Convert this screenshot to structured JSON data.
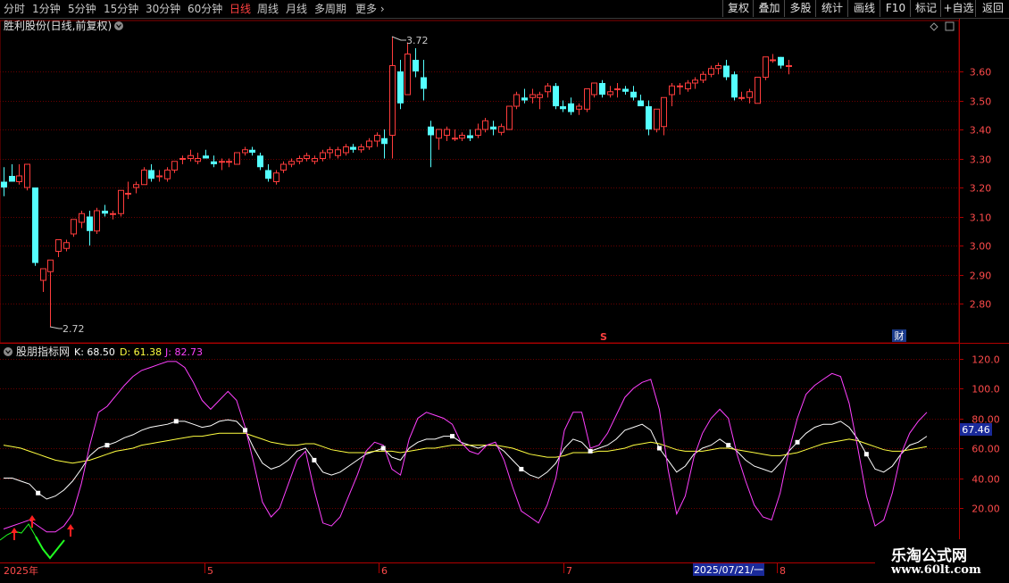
{
  "toolbar": {
    "periods": [
      "分时",
      "1分钟",
      "5分钟",
      "15分钟",
      "30分钟",
      "60分钟",
      "日线",
      "周线",
      "月线",
      "多周期",
      "更多"
    ],
    "active_period": "日线",
    "more_icon": "chevron-right-icon",
    "buttons": [
      "复权",
      "叠加",
      "多股",
      "统计",
      "画线",
      "F10",
      "标记",
      "+自选",
      "返回"
    ]
  },
  "price_panel": {
    "title": "胜利股份(日线,前复权)",
    "title_icon": "chevron-down-icon",
    "high_label": "3.72",
    "low_label": "2.72",
    "y_ticks": [
      "3.60",
      "3.50",
      "3.40",
      "3.30",
      "3.20",
      "3.10",
      "3.00",
      "2.90",
      "2.80"
    ],
    "markers": [
      "S",
      "财"
    ],
    "corner_icons": [
      "diamond-icon",
      "maximize-icon"
    ]
  },
  "indicator_panel": {
    "title": "股朋指标网",
    "title_icon": "chevron-down-icon",
    "k_label": "K: 68.50",
    "d_label": "D: 61.38",
    "j_label": "J: 82.73",
    "y_ticks": [
      "120.0",
      "100.0",
      "80.00",
      "60.00",
      "40.00",
      "20.00"
    ],
    "current_value_tag": "67.46"
  },
  "time_axis": {
    "labels": [
      "2025年",
      "5",
      "6",
      "7",
      "8"
    ],
    "cursor_date": "2025/07/21/一"
  },
  "watermark": {
    "line1": "乐淘公式网",
    "line2": "www.60lt.com"
  },
  "colors": {
    "background": "#000000",
    "up_candle": "#ff3c3c",
    "down_candle": "#54ffff",
    "k_line": "#ffffff",
    "d_line": "#ffff40",
    "j_line": "#ff40ff",
    "grid": "#6a0000",
    "axis_text": "#ff4b4b",
    "buy_arrow": "#ff2020",
    "green_segment": "#20ff20"
  },
  "chart_data": [
    {
      "type": "candlestick",
      "title": "胜利股份(日线,前复权)",
      "ylim": [
        2.72,
        3.72
      ],
      "y_ticks": [
        3.6,
        3.5,
        3.4,
        3.3,
        3.2,
        3.1,
        3.0,
        2.9,
        2.8
      ],
      "x_labels": [
        "2025年",
        "5",
        "6",
        "7",
        "8"
      ],
      "extremes": {
        "high": 3.72,
        "low": 2.72
      },
      "ohlc": [
        [
          3.22,
          3.27,
          3.17,
          3.2
        ],
        [
          3.24,
          3.28,
          3.22,
          3.22
        ],
        [
          3.22,
          3.28,
          3.21,
          3.24
        ],
        [
          3.2,
          3.28,
          3.19,
          3.28
        ],
        [
          3.2,
          3.2,
          2.93,
          2.94
        ],
        [
          2.88,
          2.92,
          2.84,
          2.92
        ],
        [
          2.91,
          2.95,
          2.72,
          2.95
        ],
        [
          2.98,
          3.02,
          2.96,
          3.02
        ],
        [
          2.99,
          3.02,
          2.98,
          3.01
        ],
        [
          3.04,
          3.09,
          3.03,
          3.09
        ],
        [
          3.08,
          3.12,
          3.06,
          3.11
        ],
        [
          3.1,
          3.12,
          3.0,
          3.05
        ],
        [
          3.05,
          3.13,
          3.04,
          3.12
        ],
        [
          3.12,
          3.14,
          3.1,
          3.11
        ],
        [
          3.11,
          3.12,
          3.09,
          3.11
        ],
        [
          3.11,
          3.19,
          3.1,
          3.19
        ],
        [
          3.18,
          3.22,
          3.16,
          3.18
        ],
        [
          3.2,
          3.22,
          3.18,
          3.21
        ],
        [
          3.21,
          3.27,
          3.21,
          3.26
        ],
        [
          3.26,
          3.28,
          3.22,
          3.23
        ],
        [
          3.24,
          3.26,
          3.22,
          3.24
        ],
        [
          3.23,
          3.27,
          3.22,
          3.26
        ],
        [
          3.26,
          3.29,
          3.25,
          3.29
        ],
        [
          3.3,
          3.31,
          3.28,
          3.3
        ],
        [
          3.3,
          3.33,
          3.29,
          3.31
        ],
        [
          3.29,
          3.32,
          3.28,
          3.3
        ],
        [
          3.31,
          3.33,
          3.3,
          3.3
        ],
        [
          3.29,
          3.31,
          3.27,
          3.28
        ],
        [
          3.29,
          3.3,
          3.26,
          3.29
        ],
        [
          3.29,
          3.3,
          3.27,
          3.29
        ],
        [
          3.28,
          3.32,
          3.28,
          3.32
        ],
        [
          3.32,
          3.34,
          3.31,
          3.33
        ],
        [
          3.33,
          3.34,
          3.31,
          3.32
        ],
        [
          3.31,
          3.32,
          3.26,
          3.27
        ],
        [
          3.26,
          3.28,
          3.22,
          3.23
        ],
        [
          3.22,
          3.26,
          3.21,
          3.25
        ],
        [
          3.26,
          3.29,
          3.25,
          3.28
        ],
        [
          3.28,
          3.3,
          3.27,
          3.29
        ],
        [
          3.29,
          3.31,
          3.28,
          3.3
        ],
        [
          3.3,
          3.32,
          3.29,
          3.31
        ],
        [
          3.29,
          3.31,
          3.28,
          3.3
        ],
        [
          3.3,
          3.33,
          3.29,
          3.32
        ],
        [
          3.32,
          3.34,
          3.3,
          3.33
        ],
        [
          3.31,
          3.34,
          3.3,
          3.33
        ],
        [
          3.32,
          3.35,
          3.31,
          3.34
        ],
        [
          3.34,
          3.35,
          3.32,
          3.33
        ],
        [
          3.33,
          3.35,
          3.32,
          3.34
        ],
        [
          3.34,
          3.37,
          3.33,
          3.36
        ],
        [
          3.36,
          3.39,
          3.34,
          3.38
        ],
        [
          3.37,
          3.4,
          3.3,
          3.35
        ],
        [
          3.38,
          3.72,
          3.3,
          3.62
        ],
        [
          3.6,
          3.64,
          3.47,
          3.49
        ],
        [
          3.52,
          3.7,
          3.52,
          3.66
        ],
        [
          3.64,
          3.68,
          3.58,
          3.6
        ],
        [
          3.58,
          3.64,
          3.5,
          3.54
        ],
        [
          3.41,
          3.43,
          3.27,
          3.38
        ],
        [
          3.37,
          3.4,
          3.33,
          3.4
        ],
        [
          3.38,
          3.41,
          3.36,
          3.4
        ],
        [
          3.37,
          3.4,
          3.36,
          3.37
        ],
        [
          3.37,
          3.39,
          3.36,
          3.38
        ],
        [
          3.38,
          3.4,
          3.36,
          3.37
        ],
        [
          3.38,
          3.42,
          3.37,
          3.4
        ],
        [
          3.4,
          3.44,
          3.39,
          3.43
        ],
        [
          3.41,
          3.43,
          3.38,
          3.4
        ],
        [
          3.39,
          3.42,
          3.38,
          3.41
        ],
        [
          3.4,
          3.48,
          3.4,
          3.48
        ],
        [
          3.48,
          3.53,
          3.47,
          3.52
        ],
        [
          3.51,
          3.54,
          3.49,
          3.5
        ],
        [
          3.51,
          3.54,
          3.49,
          3.52
        ],
        [
          3.51,
          3.53,
          3.47,
          3.52
        ],
        [
          3.53,
          3.56,
          3.51,
          3.55
        ],
        [
          3.55,
          3.56,
          3.47,
          3.48
        ],
        [
          3.48,
          3.5,
          3.46,
          3.47
        ],
        [
          3.49,
          3.51,
          3.45,
          3.46
        ],
        [
          3.47,
          3.49,
          3.45,
          3.48
        ],
        [
          3.47,
          3.54,
          3.46,
          3.54
        ],
        [
          3.52,
          3.56,
          3.51,
          3.56
        ],
        [
          3.56,
          3.57,
          3.51,
          3.52
        ],
        [
          3.52,
          3.55,
          3.51,
          3.53
        ],
        [
          3.54,
          3.56,
          3.51,
          3.54
        ],
        [
          3.54,
          3.55,
          3.52,
          3.53
        ],
        [
          3.53,
          3.55,
          3.5,
          3.51
        ],
        [
          3.5,
          3.52,
          3.48,
          3.48
        ],
        [
          3.48,
          3.5,
          3.38,
          3.4
        ],
        [
          3.4,
          3.47,
          3.39,
          3.47
        ],
        [
          3.41,
          3.5,
          3.38,
          3.51
        ],
        [
          3.52,
          3.56,
          3.48,
          3.55
        ],
        [
          3.55,
          3.56,
          3.52,
          3.55
        ],
        [
          3.54,
          3.57,
          3.53,
          3.56
        ],
        [
          3.56,
          3.58,
          3.54,
          3.57
        ],
        [
          3.57,
          3.6,
          3.56,
          3.59
        ],
        [
          3.59,
          3.62,
          3.58,
          3.61
        ],
        [
          3.61,
          3.63,
          3.59,
          3.62
        ],
        [
          3.62,
          3.64,
          3.57,
          3.58
        ],
        [
          3.59,
          3.6,
          3.5,
          3.51
        ],
        [
          3.51,
          3.53,
          3.5,
          3.51
        ],
        [
          3.51,
          3.54,
          3.49,
          3.53
        ],
        [
          3.49,
          3.58,
          3.49,
          3.58
        ],
        [
          3.58,
          3.65,
          3.57,
          3.65
        ],
        [
          3.64,
          3.66,
          3.63,
          3.64
        ],
        [
          3.65,
          3.65,
          3.61,
          3.62
        ],
        [
          3.62,
          3.64,
          3.59,
          3.62
        ]
      ]
    },
    {
      "type": "line",
      "title": "股朋指标网",
      "ylim": [
        0,
        130
      ],
      "y_ticks": [
        120,
        100,
        80,
        60,
        40,
        20
      ],
      "series": [
        {
          "name": "K",
          "values": [
            40,
            40,
            38,
            36,
            30,
            26,
            28,
            32,
            38,
            46,
            55,
            60,
            62,
            64,
            67,
            69,
            72,
            74,
            75,
            76,
            78,
            78,
            76,
            74,
            75,
            78,
            79,
            78,
            72,
            60,
            50,
            46,
            48,
            52,
            58,
            60,
            52,
            44,
            42,
            44,
            48,
            52,
            56,
            58,
            60,
            54,
            52,
            60,
            64,
            66,
            66,
            68,
            68,
            64,
            62,
            60,
            62,
            62,
            58,
            52,
            46,
            42,
            40,
            44,
            50,
            60,
            66,
            64,
            58,
            60,
            62,
            66,
            72,
            74,
            76,
            72,
            60,
            52,
            44,
            48,
            56,
            60,
            62,
            66,
            62,
            58,
            52,
            48,
            46,
            44,
            50,
            58,
            64,
            70,
            74,
            76,
            76,
            78,
            74,
            66,
            56,
            46,
            44,
            48,
            56,
            62,
            64,
            68
          ]
        },
        {
          "name": "D",
          "values": [
            62,
            61,
            60,
            58,
            56,
            54,
            52,
            51,
            50,
            51,
            52,
            54,
            56,
            58,
            59,
            60,
            62,
            63,
            64,
            65,
            66,
            67,
            68,
            68,
            69,
            70,
            70,
            70,
            70,
            68,
            66,
            64,
            63,
            62,
            62,
            63,
            63,
            61,
            59,
            58,
            57,
            57,
            57,
            58,
            58,
            58,
            57,
            58,
            59,
            60,
            60,
            61,
            62,
            62,
            62,
            62,
            62,
            62,
            61,
            60,
            58,
            56,
            55,
            54,
            54,
            55,
            57,
            57,
            57,
            58,
            58,
            59,
            60,
            62,
            63,
            64,
            63,
            61,
            59,
            58,
            58,
            58,
            59,
            60,
            60,
            59,
            58,
            57,
            56,
            55,
            55,
            56,
            57,
            59,
            61,
            63,
            64,
            65,
            66,
            65,
            63,
            61,
            59,
            58,
            58,
            59,
            60,
            61
          ]
        },
        {
          "name": "J",
          "values": [
            6,
            8,
            10,
            12,
            8,
            4,
            4,
            8,
            16,
            36,
            62,
            84,
            88,
            95,
            102,
            108,
            112,
            114,
            116,
            118,
            118,
            114,
            104,
            92,
            86,
            92,
            98,
            92,
            74,
            50,
            24,
            14,
            20,
            36,
            52,
            58,
            32,
            10,
            8,
            14,
            28,
            42,
            58,
            64,
            62,
            46,
            42,
            66,
            80,
            84,
            82,
            80,
            76,
            64,
            58,
            56,
            62,
            64,
            52,
            34,
            18,
            14,
            10,
            22,
            40,
            72,
            84,
            84,
            60,
            62,
            70,
            82,
            94,
            100,
            104,
            106,
            86,
            46,
            16,
            28,
            54,
            70,
            80,
            86,
            80,
            56,
            38,
            22,
            14,
            12,
            30,
            58,
            80,
            96,
            102,
            106,
            110,
            108,
            90,
            60,
            28,
            8,
            12,
            30,
            56,
            70,
            78,
            84
          ]
        }
      ],
      "signals": {
        "buy_arrows": 3,
        "green_segment": true
      }
    }
  ]
}
